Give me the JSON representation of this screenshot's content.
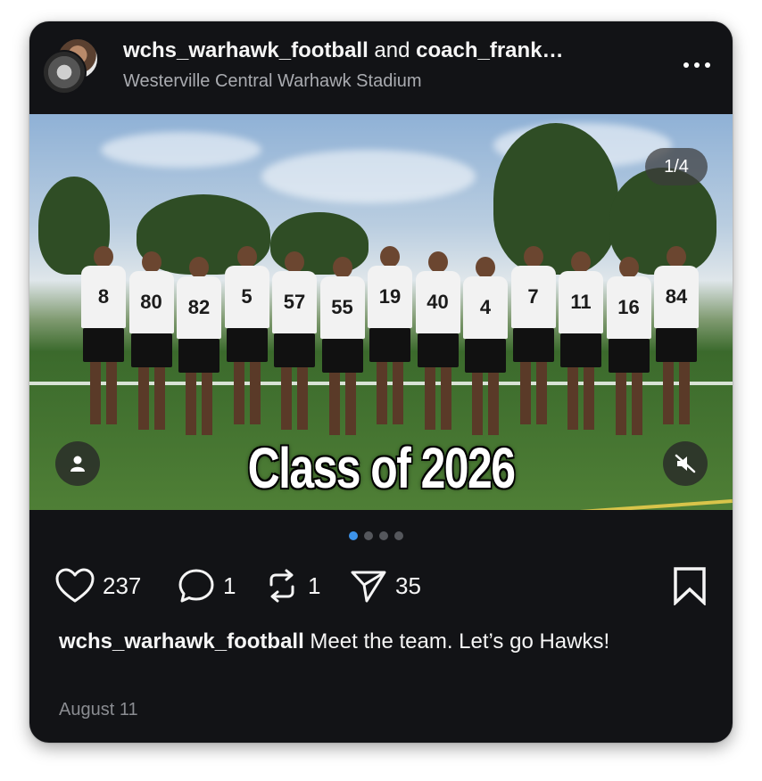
{
  "header": {
    "author_primary": "wchs_warhawk_football",
    "joiner": "and",
    "author_secondary": "coach_frank…",
    "location": "Westerville Central Warhawk Stadium",
    "more_icon": "more-horizontal-icon"
  },
  "media": {
    "counter": "1/4",
    "overlay_text": "Class of 2026",
    "jersey_numbers": [
      "8",
      "80",
      "82",
      "5",
      "57",
      "55",
      "19",
      "40",
      "4",
      "7",
      "11",
      "16",
      "84"
    ],
    "user_tag_icon": "person-icon",
    "mute_icon": "speaker-muted-icon"
  },
  "carousel": {
    "total": 4,
    "active_index": 0
  },
  "actions": {
    "likes": "237",
    "comments": "1",
    "reposts": "1",
    "shares": "35"
  },
  "caption": {
    "username": "wchs_warhawk_football",
    "text": "Meet the team. Let’s go Hawks!"
  },
  "date": "August 11",
  "colors": {
    "card_bg": "#121316",
    "accent_dot": "#3d93ea",
    "secondary_text": "#a9abb0"
  }
}
